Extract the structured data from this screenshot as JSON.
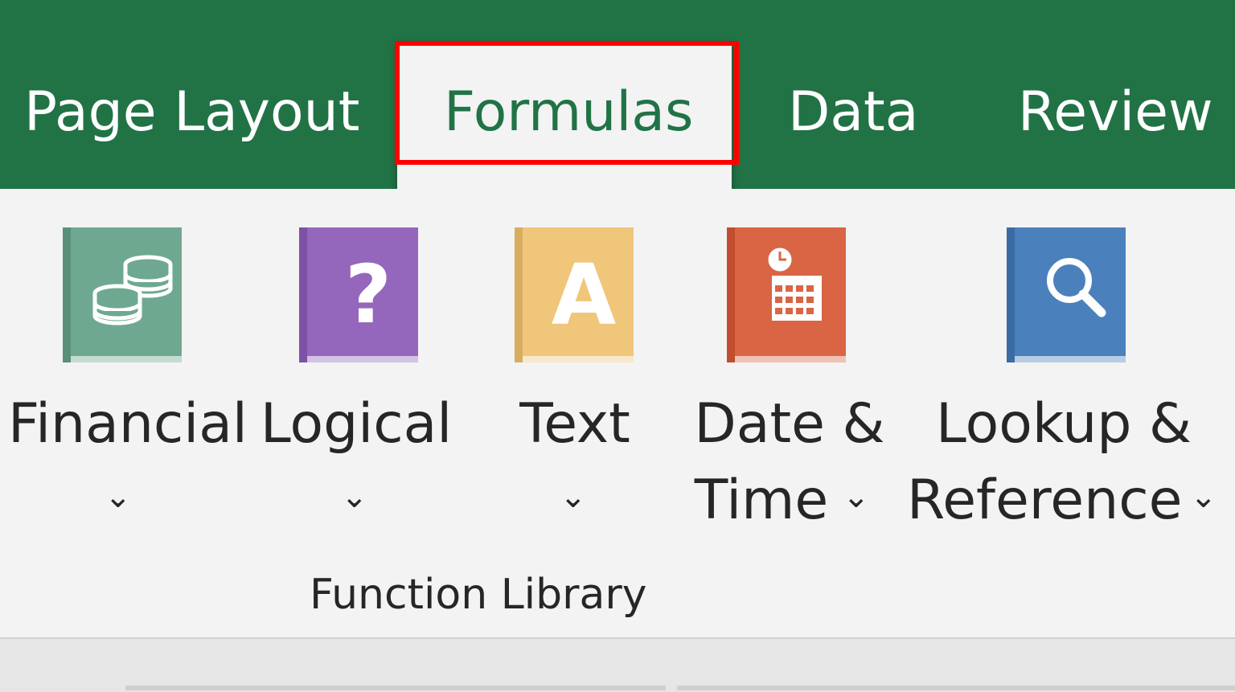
{
  "tabs": {
    "page_layout": "Page Layout",
    "formulas": "Formulas",
    "data": "Data",
    "review": "Review"
  },
  "function_library": {
    "group_label": "Function Library",
    "commands": [
      {
        "line1": "Financial",
        "line2": "",
        "icon": "financial-coins-book-icon",
        "color": "#6fa891"
      },
      {
        "line1": "Logical",
        "line2": "",
        "icon": "logical-question-book-icon",
        "color": "#9467bd"
      },
      {
        "line1": "Text",
        "line2": "",
        "icon": "text-letter-a-book-icon",
        "color": "#efc67a"
      },
      {
        "line1": "Date &",
        "line2": "Time",
        "icon": "date-time-calendar-book-icon",
        "color": "#d96544"
      },
      {
        "line1": "Lookup &",
        "line2": "Reference",
        "icon": "lookup-magnifier-book-icon",
        "color": "#4a80bb"
      }
    ]
  },
  "colors": {
    "ribbon_green": "#217346",
    "highlight_red": "#ff0000"
  }
}
